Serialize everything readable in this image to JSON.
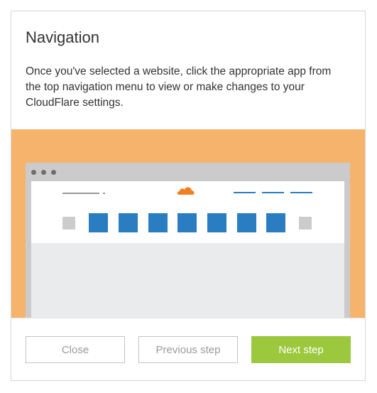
{
  "modal": {
    "title": "Navigation",
    "description": "Once you've selected a website, click the appropriate app from the top navigation menu to view or make changes to your CloudFlare settings."
  },
  "illustration": {
    "icons": [
      "browser-window",
      "cloudflare-cloud-logo"
    ],
    "colors": {
      "background": "#f6b36b",
      "browser_frame": "#cbcbcb",
      "accent_blue": "#2b7dc2",
      "cloud_orange": "#f38020"
    }
  },
  "buttons": {
    "close": "Close",
    "previous": "Previous step",
    "next": "Next step"
  },
  "colors": {
    "primary_button": "#9bc83d"
  }
}
